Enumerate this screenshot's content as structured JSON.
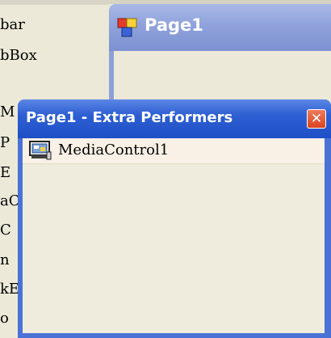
{
  "toolbox": {
    "items": [
      "bar",
      "bBox",
      "",
      "M",
      "P",
      "E",
      "aC",
      "C",
      "n",
      "kE",
      "o"
    ]
  },
  "background_window": {
    "title": "Page1"
  },
  "dialog": {
    "title": "Page1 - Extra Performers",
    "components": [
      {
        "label": "MediaControl1",
        "icon": "media-control-icon"
      }
    ]
  },
  "colors": {
    "dialog_title": "#2e5fd2",
    "close_button": "#d9431f",
    "background_title": "#8fa2db"
  }
}
